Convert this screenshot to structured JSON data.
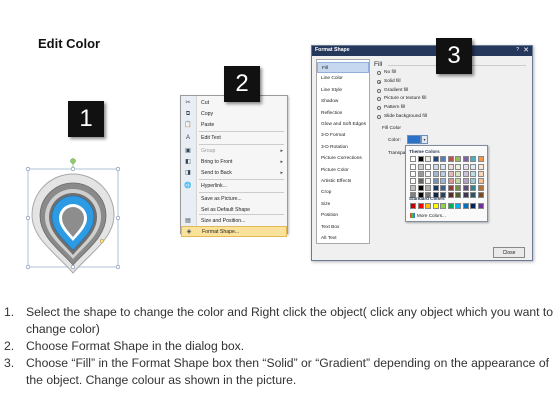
{
  "title": "Edit Color",
  "step_badges": [
    "1",
    "2",
    "3"
  ],
  "context_menu": {
    "items": [
      {
        "label": "Cut",
        "icon": "cut-icon",
        "glyph": "✂",
        "underline": "t",
        "disabled": false
      },
      {
        "label": "Copy",
        "icon": "copy-icon",
        "glyph": "⧉",
        "disabled": false
      },
      {
        "label": "Paste",
        "icon": "paste-icon",
        "glyph": "📋",
        "disabled": false
      },
      {
        "label": "Edit Text",
        "icon": "edit-text-icon",
        "glyph": "A",
        "disabled": false
      },
      {
        "label": "Group",
        "icon": "group-icon",
        "glyph": "▣",
        "disabled": true,
        "submenu": true
      },
      {
        "label": "Bring to Front",
        "icon": "bring-front-icon",
        "glyph": "◧",
        "disabled": false,
        "submenu": true
      },
      {
        "label": "Send to Back",
        "icon": "send-back-icon",
        "glyph": "◨",
        "disabled": false,
        "submenu": true
      },
      {
        "label": "Hyperlink...",
        "icon": "hyperlink-icon",
        "glyph": "🌐",
        "disabled": false
      },
      {
        "label": "Save as Picture...",
        "icon": "",
        "glyph": "",
        "disabled": false
      },
      {
        "label": "Set as Default Shape",
        "icon": "",
        "glyph": "",
        "disabled": false
      },
      {
        "label": "Size and Position...",
        "icon": "size-position-icon",
        "glyph": "▤",
        "disabled": false
      },
      {
        "label": "Format Shape...",
        "icon": "format-shape-icon",
        "glyph": "◈",
        "disabled": false,
        "highlighted": true
      }
    ]
  },
  "dialog": {
    "title": "Format Shape",
    "help": "?",
    "close_glyph": "✕",
    "categories": [
      "Fill",
      "Line Color",
      "Line Style",
      "Shadow",
      "Reflection",
      "Glow and Soft Edges",
      "3-D Format",
      "3-D Rotation",
      "Picture Corrections",
      "Picture Color",
      "Artistic Effects",
      "Crop",
      "Size",
      "Position",
      "Text Box",
      "Alt Text"
    ],
    "selected_category": "Fill",
    "section_heading": "Fill",
    "fill_options": [
      {
        "label": "No fill",
        "checked": false
      },
      {
        "label": "Solid fill",
        "checked": true
      },
      {
        "label": "Gradient fill",
        "checked": false
      },
      {
        "label": "Picture or texture fill",
        "checked": false
      },
      {
        "label": "Pattern fill",
        "checked": false
      },
      {
        "label": "Slide background fill",
        "checked": false
      }
    ],
    "fill_color_heading": "Fill Color",
    "color_label": "Color:",
    "transparency_label": "Transpa",
    "current_color": "#2a72c8",
    "close_button": "Close"
  },
  "palette": {
    "theme_heading": "Theme Colors",
    "standard_heading": "Standard Colors",
    "more_colors": "More Colors...",
    "theme_top": [
      "#ffffff",
      "#000000",
      "#eeece1",
      "#1f497d",
      "#4f81bd",
      "#c0504d",
      "#9bbb59",
      "#8064a2",
      "#4bacc6",
      "#f79646"
    ],
    "standard": [
      "#c00000",
      "#ff0000",
      "#ffc000",
      "#ffff00",
      "#92d050",
      "#00b050",
      "#00b0f0",
      "#0070c0",
      "#002060",
      "#7030a0"
    ]
  },
  "instructions": [
    {
      "num": "1.",
      "text": "Select the shape to change the color and Right click the object( click any object which you want to change color)"
    },
    {
      "num": "2.",
      "text": "Choose Format Shape in the dialog box."
    },
    {
      "num": "3.",
      "text": "Choose “Fill” in the Format Shape box then “Solid” or “Gradient” depending on the appearance of the object. Change colour as shown in the picture."
    }
  ]
}
